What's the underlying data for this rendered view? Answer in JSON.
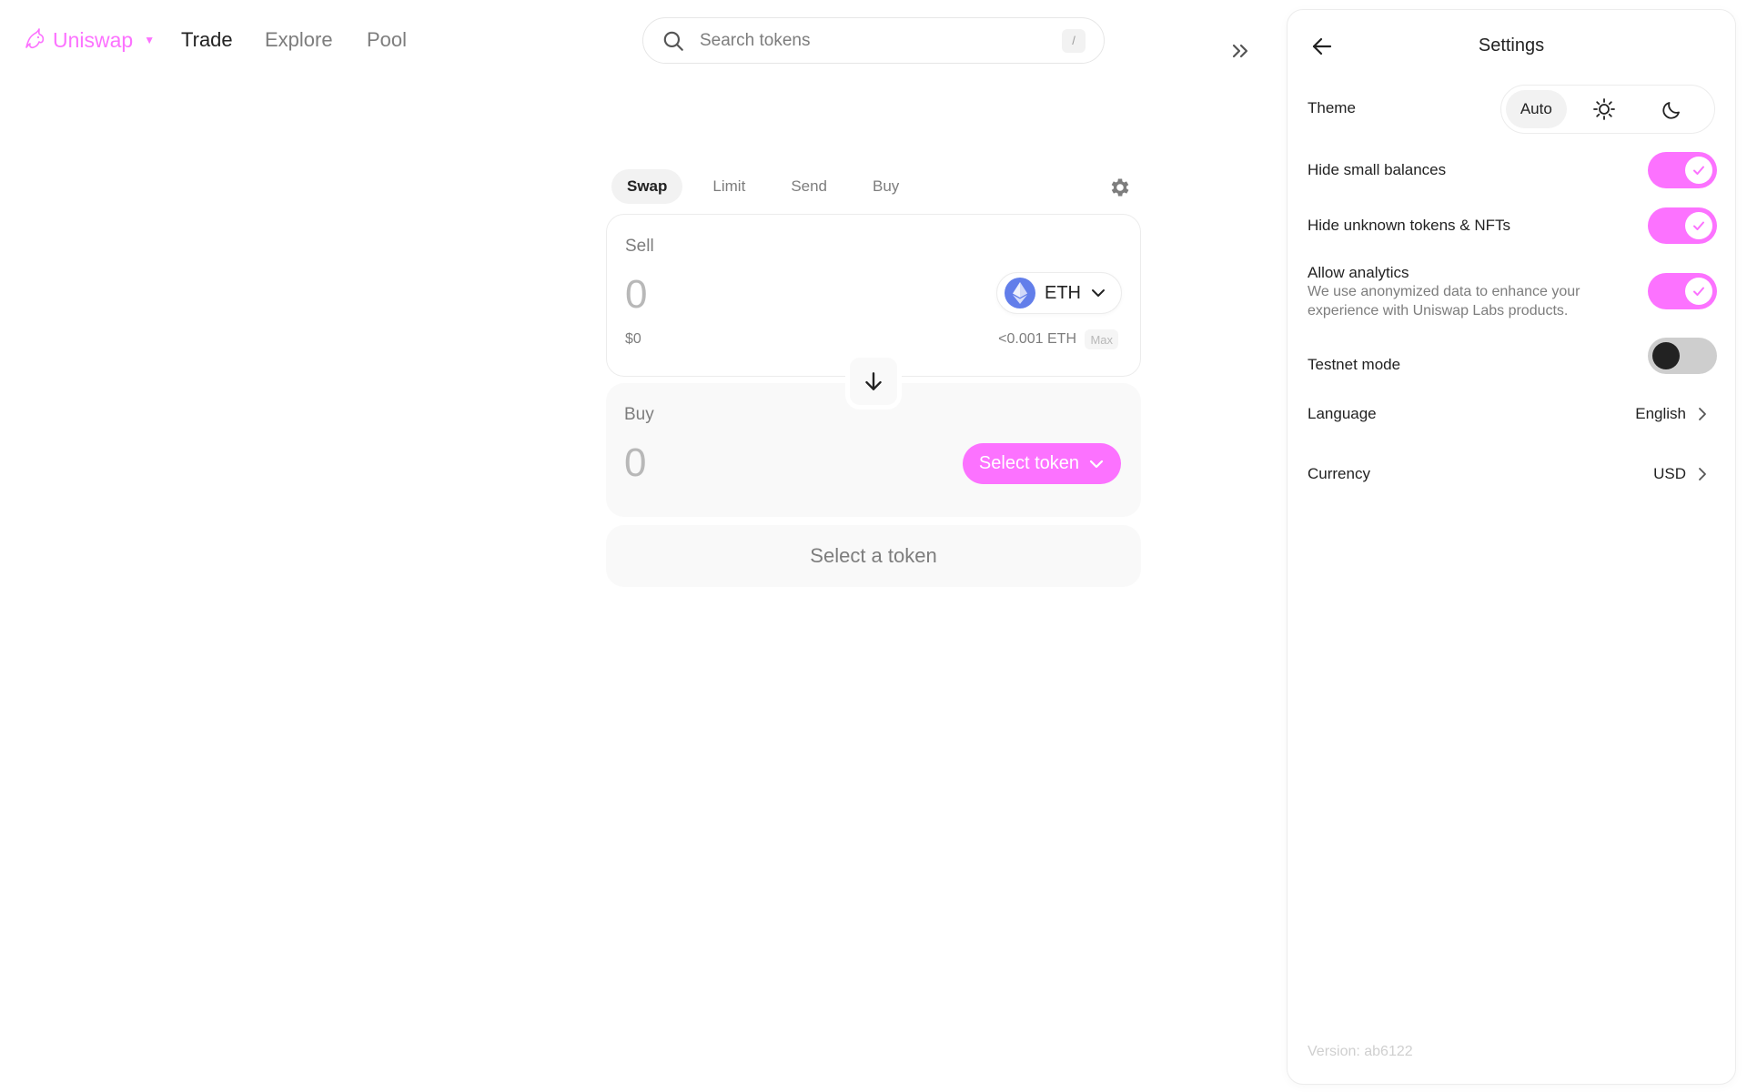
{
  "header": {
    "brand": "Uniswap",
    "nav": [
      "Trade",
      "Explore",
      "Pool"
    ],
    "search_placeholder": "Search tokens",
    "search_shortcut": "/"
  },
  "swap": {
    "tabs": [
      "Swap",
      "Limit",
      "Send",
      "Buy"
    ],
    "sell": {
      "label": "Sell",
      "amount": "0",
      "usd_value": "$0",
      "token": "ETH",
      "balance": "<0.001 ETH",
      "max_label": "Max"
    },
    "buy": {
      "label": "Buy",
      "amount": "0",
      "select_label": "Select token"
    },
    "cta_label": "Select a token"
  },
  "settings": {
    "title": "Settings",
    "theme": {
      "label": "Theme",
      "options": [
        "Auto",
        "sun-icon",
        "moon-icon"
      ],
      "selected": "Auto"
    },
    "toggles": [
      {
        "label": "Hide small balances",
        "on": true
      },
      {
        "label": "Hide unknown tokens & NFTs",
        "on": true
      },
      {
        "label": "Allow analytics",
        "description": "We use anonymized data to enhance your experience with Uniswap Labs products.",
        "on": true
      },
      {
        "label": "Testnet mode",
        "on": false
      }
    ],
    "language": {
      "label": "Language",
      "value": "English"
    },
    "currency": {
      "label": "Currency",
      "value": "USD"
    },
    "version": "Version: ab6122"
  },
  "colors": {
    "accent": "#fc72ff",
    "eth": "#627eea",
    "text": "#222222",
    "muted": "#7d7d7d"
  }
}
